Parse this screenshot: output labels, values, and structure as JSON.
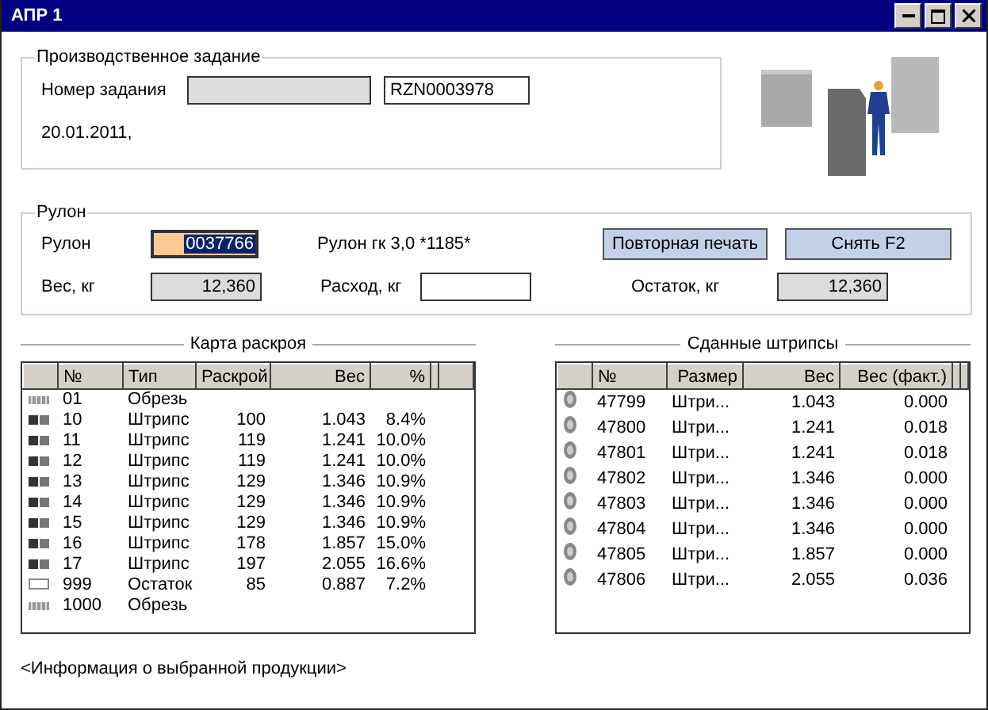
{
  "window": {
    "title": "АПР 1"
  },
  "production_task": {
    "title": "Производственное задание",
    "task_label": "Номер задания",
    "task_fields": [
      {
        "disabled": true
      },
      {
        "value": "RZN0003978",
        "disabled": false
      }
    ],
    "date": "20.01.2011,"
  },
  "roll": {
    "title": "Рулон",
    "roll_label": "Рулон",
    "roll_field": {
      "value": "0037766",
      "selected": true
    },
    "roll_description": "Рулон гк 3,0 *1185*",
    "buttons": [
      "Повторная печать",
      "Снять F2"
    ],
    "fields": [
      {
        "label": "Вес, кг",
        "value": "12,360",
        "disabled": true
      },
      {
        "label": "Расход, кг",
        "disabled": false
      },
      {
        "label": "Остаток, кг",
        "value": "12,360",
        "disabled": true
      }
    ]
  },
  "cut_map": {
    "title": "Карта раскроя",
    "columns": [
      "№",
      "Тип",
      "Раскрой",
      "Вес",
      "%"
    ],
    "rows": [
      {
        "kind": "trim",
        "cells": [
          "01",
          "Обрезь"
        ]
      },
      {
        "kind": "strip",
        "cells": [
          "10",
          "Штрипс",
          "100",
          "1.043",
          "8.4%"
        ]
      },
      {
        "kind": "strip",
        "cells": [
          "11",
          "Штрипс",
          "119",
          "1.241",
          "10.0%"
        ]
      },
      {
        "kind": "strip",
        "cells": [
          "12",
          "Штрипс",
          "119",
          "1.241",
          "10.0%"
        ]
      },
      {
        "kind": "strip",
        "cells": [
          "13",
          "Штрипс",
          "129",
          "1.346",
          "10.9%"
        ]
      },
      {
        "kind": "strip",
        "cells": [
          "14",
          "Штрипс",
          "129",
          "1.346",
          "10.9%"
        ]
      },
      {
        "kind": "strip",
        "cells": [
          "15",
          "Штрипс",
          "129",
          "1.346",
          "10.9%"
        ]
      },
      {
        "kind": "strip",
        "cells": [
          "16",
          "Штрипс",
          "178",
          "1.857",
          "15.0%"
        ]
      },
      {
        "kind": "strip",
        "cells": [
          "17",
          "Штрипс",
          "197",
          "2.055",
          "16.6%"
        ]
      },
      {
        "kind": "remainder",
        "cells": [
          "999",
          "Остаток",
          "85",
          "0.887",
          "7.2%"
        ]
      },
      {
        "kind": "trim",
        "cells": [
          "1000",
          "Обрезь"
        ]
      }
    ]
  },
  "delivered_strips": {
    "title": "Сданные штрипсы",
    "columns": [
      "№",
      "Размер",
      "Вес",
      "Вес (факт.)"
    ],
    "rows": [
      {
        "cells": [
          "47799",
          "Штри...",
          "1.043",
          "0.000"
        ]
      },
      {
        "cells": [
          "47800",
          "Штри...",
          "1.241",
          "0.018"
        ]
      },
      {
        "cells": [
          "47801",
          "Штри...",
          "1.241",
          "0.018"
        ]
      },
      {
        "cells": [
          "47802",
          "Штри...",
          "1.346",
          "0.000"
        ]
      },
      {
        "cells": [
          "47803",
          "Штри...",
          "1.346",
          "0.000"
        ]
      },
      {
        "cells": [
          "47804",
          "Штри...",
          "1.346",
          "0.000"
        ]
      },
      {
        "cells": [
          "47805",
          "Штри...",
          "1.857",
          "0.000"
        ]
      },
      {
        "cells": [
          "47806",
          "Штри...",
          "2.055",
          "0.036"
        ]
      }
    ]
  },
  "footer": "<Информация о выбранной продукции>"
}
